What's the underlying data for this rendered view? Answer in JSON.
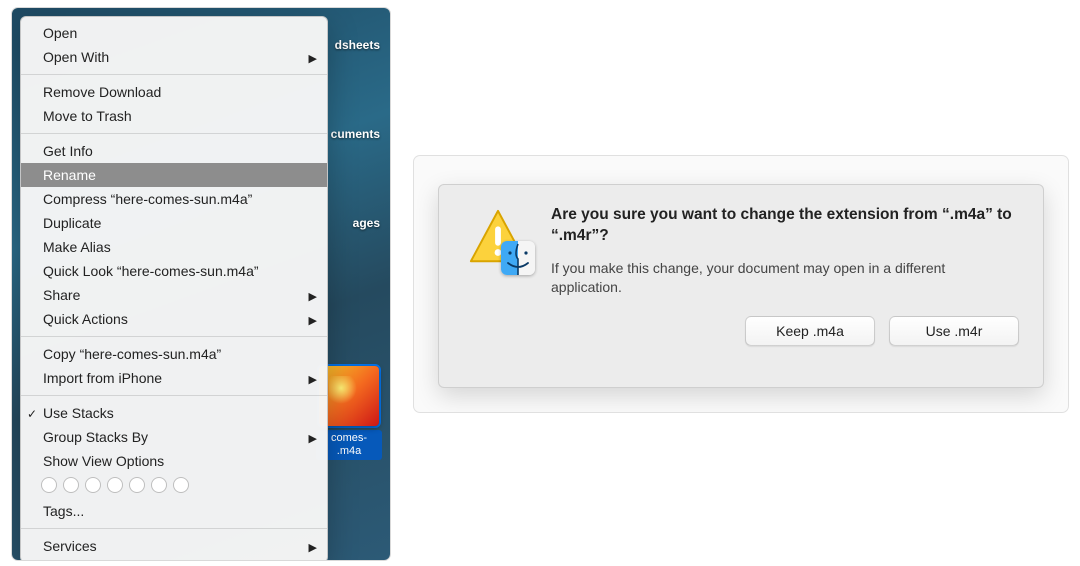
{
  "desktop": {
    "stack_labels": [
      "dsheets",
      "cuments",
      "ages"
    ],
    "file_name": "comes-\n.m4a"
  },
  "context_menu": {
    "items": [
      {
        "label": "Open",
        "submenu": false
      },
      {
        "label": "Open With",
        "submenu": true
      }
    ],
    "items2": [
      {
        "label": "Remove Download",
        "submenu": false
      },
      {
        "label": "Move to Trash",
        "submenu": false
      }
    ],
    "items3": [
      {
        "label": "Get Info",
        "submenu": false
      },
      {
        "label": "Rename",
        "submenu": false,
        "highlight": true
      },
      {
        "label": "Compress “here-comes-sun.m4a”",
        "submenu": false
      },
      {
        "label": "Duplicate",
        "submenu": false
      },
      {
        "label": "Make Alias",
        "submenu": false
      },
      {
        "label": "Quick Look “here-comes-sun.m4a”",
        "submenu": false
      },
      {
        "label": "Share",
        "submenu": true
      },
      {
        "label": "Quick Actions",
        "submenu": true
      }
    ],
    "items4": [
      {
        "label": "Copy “here-comes-sun.m4a”",
        "submenu": false
      },
      {
        "label": "Import from iPhone",
        "submenu": true
      }
    ],
    "items5": [
      {
        "label": "Use Stacks",
        "submenu": false,
        "checked": true
      },
      {
        "label": "Group Stacks By",
        "submenu": true
      },
      {
        "label": "Show View Options",
        "submenu": false
      }
    ],
    "tags_label": "Tags...",
    "services_label": "Services",
    "services_submenu": true
  },
  "dialog": {
    "title": "Are you sure you want to change the extension from “.m4a” to “.m4r”?",
    "subtext": "If you make this change, your document may open in a different application.",
    "keep_button": "Keep .m4a",
    "use_button": "Use .m4r"
  }
}
